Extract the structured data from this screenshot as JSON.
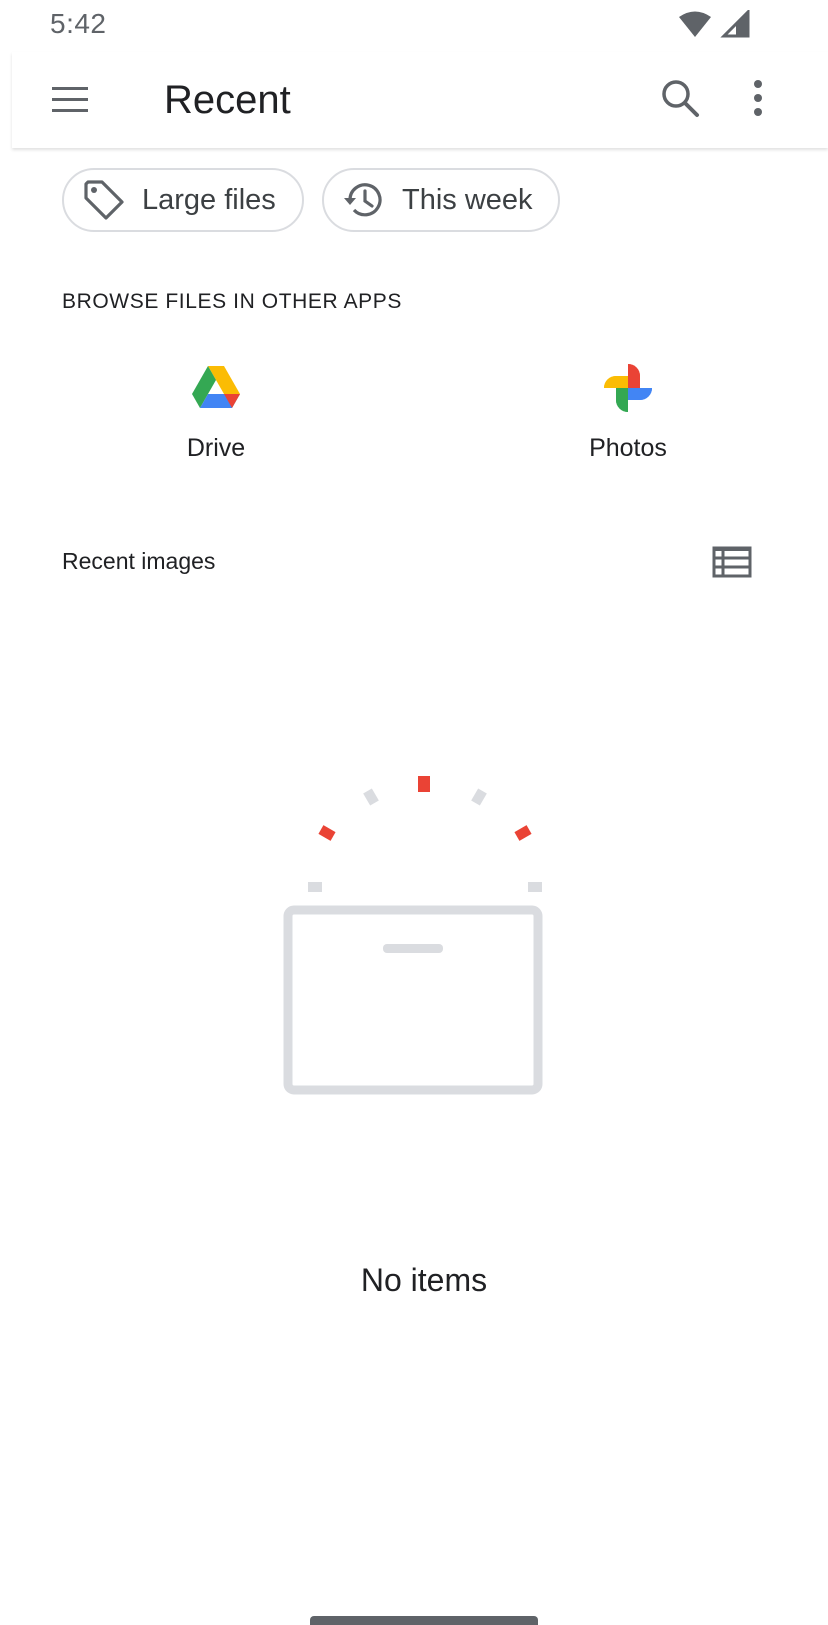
{
  "status_bar": {
    "time": "5:42"
  },
  "app_bar": {
    "title": "Recent"
  },
  "chips": [
    {
      "label": "Large files",
      "icon": "tag-icon"
    },
    {
      "label": "This week",
      "icon": "history-icon"
    }
  ],
  "browse_section": {
    "header": "BROWSE FILES IN OTHER APPS",
    "apps": [
      {
        "label": "Drive",
        "icon": "drive-icon"
      },
      {
        "label": "Photos",
        "icon": "photos-icon"
      }
    ]
  },
  "recent_images": {
    "header": "Recent images",
    "empty_text": "No items"
  },
  "colors": {
    "accent_red": "#ea4335",
    "illustration_gray": "#dadce0",
    "google_blue": "#4285f4",
    "google_green": "#34a853",
    "google_yellow": "#fbbc04"
  }
}
